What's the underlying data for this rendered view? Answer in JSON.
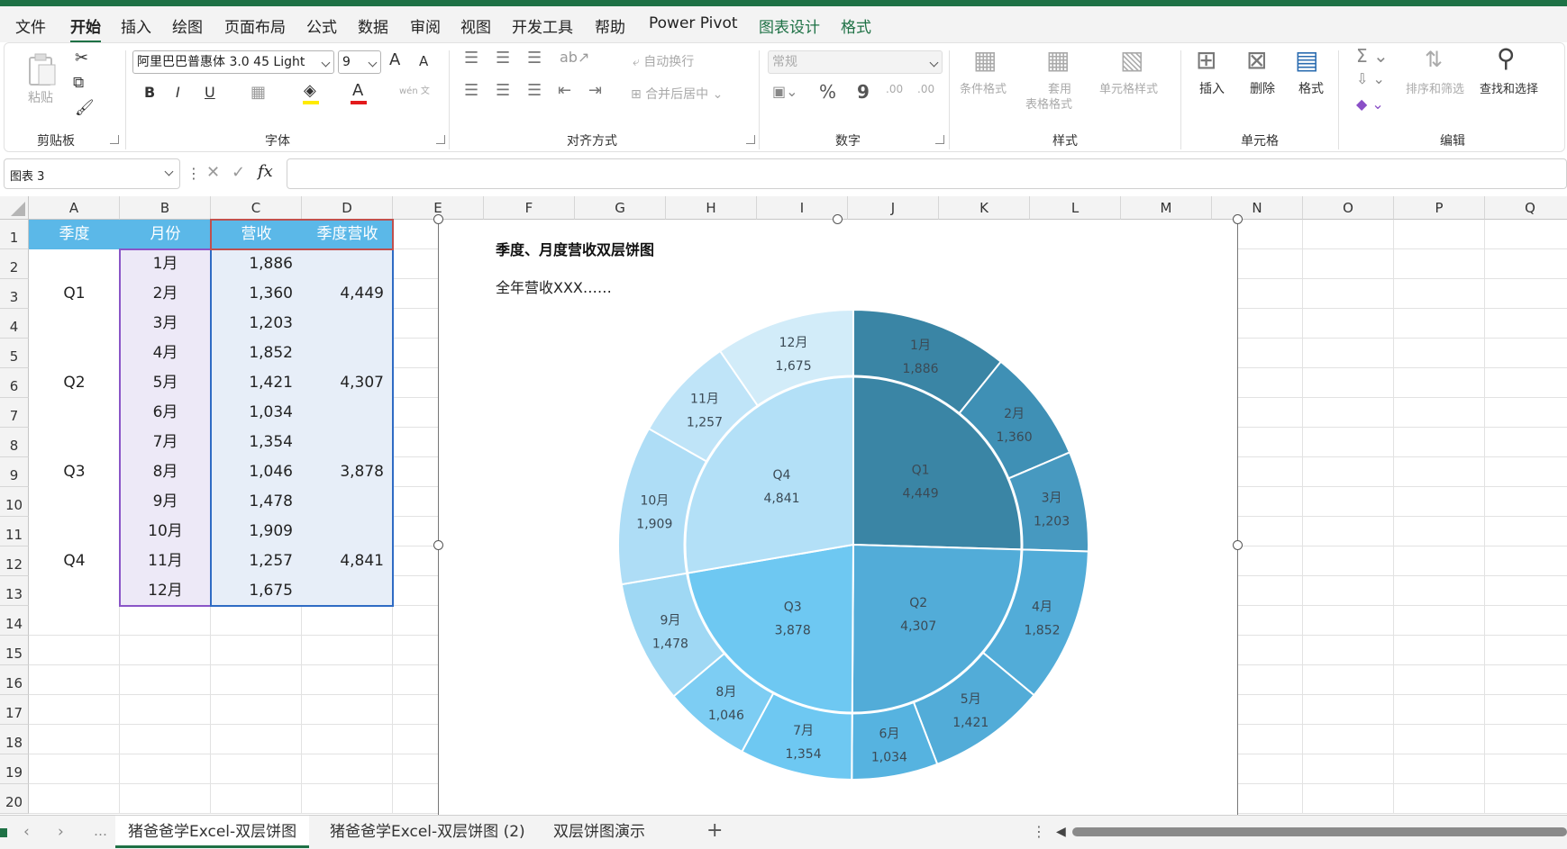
{
  "menu": {
    "items": [
      "文件",
      "开始",
      "插入",
      "绘图",
      "页面布局",
      "公式",
      "数据",
      "审阅",
      "视图",
      "开发工具",
      "帮助",
      "Power Pivot",
      "图表设计",
      "格式"
    ],
    "active": "开始"
  },
  "ribbon": {
    "clipboard": {
      "paste": "粘贴",
      "label": "剪贴板"
    },
    "font": {
      "name": "阿里巴巴普惠体 3.0 45 Light",
      "size": "9",
      "label": "字体",
      "bold": "B",
      "italic": "I",
      "underline": "U",
      "grow": "A",
      "shrink": "A",
      "fontcolor": "A",
      "phonetic": "wén 文"
    },
    "alignment": {
      "wrap": "自动换行",
      "merge": "合并后居中",
      "label": "对齐方式"
    },
    "number": {
      "format": "常规",
      "percent": "%",
      "comma": "9",
      "inc": ".00",
      "dec": ".00",
      "label": "数字"
    },
    "styles": {
      "conditional": "条件格式",
      "table1": "套用",
      "table2": "表格格式",
      "cell": "单元格样式",
      "label": "样式"
    },
    "cells": {
      "insert": "插入",
      "delete": "删除",
      "format": "格式",
      "label": "单元格"
    },
    "editing": {
      "sort": "排序和筛选",
      "find": "查找和选择",
      "label": "编辑"
    }
  },
  "formula_bar": {
    "name_box": "图表 3",
    "fx": "fx",
    "value": ""
  },
  "columns": [
    "A",
    "B",
    "C",
    "D",
    "E",
    "F",
    "G",
    "H",
    "I",
    "J",
    "K",
    "L",
    "M",
    "N",
    "O",
    "P",
    "Q"
  ],
  "rows": [
    "1",
    "2",
    "3",
    "4",
    "5",
    "6",
    "7",
    "8",
    "9",
    "10",
    "11",
    "12",
    "13",
    "14",
    "15",
    "16",
    "17",
    "18",
    "19",
    "20"
  ],
  "table": {
    "headers": [
      "季度",
      "月份",
      "营收",
      "季度营收"
    ],
    "quarters": [
      "Q1",
      "Q2",
      "Q3",
      "Q4"
    ],
    "months": [
      "1月",
      "2月",
      "3月",
      "4月",
      "5月",
      "6月",
      "7月",
      "8月",
      "9月",
      "10月",
      "11月",
      "12月"
    ],
    "revenue": [
      "1,886",
      "1,360",
      "1,203",
      "1,852",
      "1,421",
      "1,034",
      "1,354",
      "1,046",
      "1,478",
      "1,909",
      "1,257",
      "1,675"
    ],
    "quarter_revenue": [
      "4,449",
      "4,307",
      "3,878",
      "4,841"
    ]
  },
  "chart_title": "季度、月度营收双层饼图",
  "chart_subtitle": "全年营收XXX……",
  "chart_data": {
    "type": "pie",
    "title": "季度、月度营收双层饼图",
    "subtitle": "全年营收XXX……",
    "inner": {
      "categories": [
        "Q1",
        "Q2",
        "Q3",
        "Q4"
      ],
      "values": [
        4449,
        4307,
        3878,
        4841
      ],
      "colors": [
        "#3a85a5",
        "#52acd8",
        "#6ec8f2",
        "#b3e0f7"
      ]
    },
    "outer": {
      "categories": [
        "1月",
        "2月",
        "3月",
        "4月",
        "5月",
        "6月",
        "7月",
        "8月",
        "9月",
        "10月",
        "11月",
        "12月"
      ],
      "values": [
        1886,
        1360,
        1203,
        1852,
        1421,
        1034,
        1354,
        1046,
        1478,
        1909,
        1257,
        1675
      ],
      "colors": [
        "#3a85a5",
        "#3f90b5",
        "#4799c0",
        "#52acd8",
        "#52acd8",
        "#56b3e0",
        "#6ec8f2",
        "#7dcdf3",
        "#9fd8f4",
        "#aeddf6",
        "#bfe4f8",
        "#d2ecf9"
      ]
    }
  },
  "sheet_tabs": [
    "猪爸爸学Excel-双层饼图",
    "猪爸爸学Excel-双层饼图 (2)",
    "双层饼图演示"
  ],
  "active_sheet": "猪爸爸学Excel-双层饼图",
  "add_sheet": "+"
}
